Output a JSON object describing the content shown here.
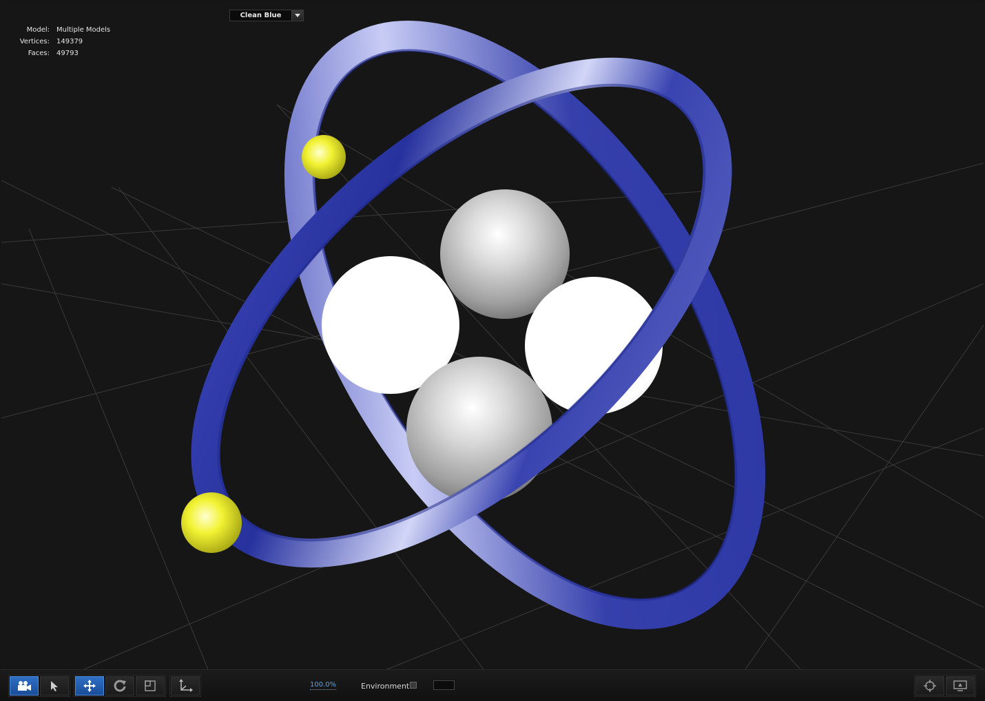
{
  "model_info": {
    "model_label": "Model:",
    "model_value": "Multiple Models",
    "vertices_label": "Vertices:",
    "vertices_value": "149379",
    "faces_label": "Faces:",
    "faces_value": "49793"
  },
  "toolbar": {
    "tools": [
      {
        "icon": "camera-icon",
        "active": true
      },
      {
        "icon": "pointer-icon",
        "active": false
      },
      {
        "icon": "move-icon",
        "active": true
      },
      {
        "icon": "rotate-icon",
        "active": false
      },
      {
        "icon": "scale-icon",
        "active": false
      },
      {
        "icon": "axes-icon",
        "active": false
      }
    ],
    "preset": {
      "value": "Clean Blue"
    },
    "zoom": "100.0%",
    "environment_label": "Environment",
    "environment_checked": false,
    "right_icons": [
      "target-icon",
      "monitor-icon"
    ]
  },
  "scene": {
    "ring_color": "#2f3aa8",
    "ring_highlight": "#c9cdf5",
    "electron_color": "#e8e82a",
    "nucleus_color": "#d9d9d9",
    "background": "#161617",
    "grid_color": "#3a3a3a"
  }
}
